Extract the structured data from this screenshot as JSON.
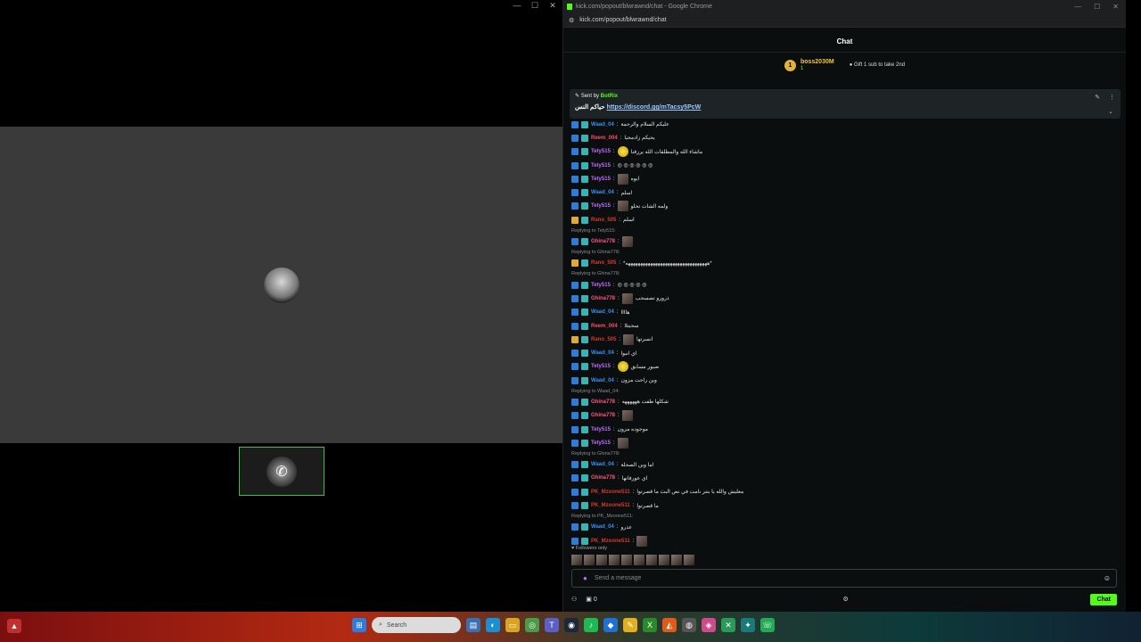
{
  "left": {
    "window_controls": [
      "—",
      "☐",
      "✕"
    ]
  },
  "chrome": {
    "title": "kick.com/popout/blwrawnd/chat - Google Chrome",
    "url": "kick.com/popout/blwrawnd/chat",
    "window_controls": [
      "—",
      "☐",
      "✕"
    ]
  },
  "chat": {
    "header": "Chat",
    "top_gifter": {
      "rank": "1",
      "name": "boss2030M",
      "count": "1",
      "cta": "Gift 1 sub to take 2nd"
    },
    "pinned": {
      "sent_by_label": "Sent by",
      "sender": "BotRix",
      "prefix": "حياكم النس",
      "link": "https://discord.gg/mTacsy5PcW"
    },
    "messages": [
      {
        "type": "msg",
        "user": "Waad_04",
        "cls": "n-waad",
        "text": "عليكم السلام والرحمة"
      },
      {
        "type": "msg",
        "user": "Reem_004",
        "cls": "n-reem",
        "text": "يحيكم زادمحيا"
      },
      {
        "type": "msg",
        "user": "Tety515",
        "cls": "n-tety",
        "text": "ماشاء الله والمطلقات الله يرزقنا",
        "emote": "y"
      },
      {
        "type": "msg",
        "user": "Tety515",
        "cls": "n-tety",
        "text": "◎ ◎ ◎ ◎ ◎ ◎"
      },
      {
        "type": "msg",
        "user": "Tety515",
        "cls": "n-tety",
        "text": "ايوه",
        "emote": "e"
      },
      {
        "type": "msg",
        "user": "Waad_04",
        "cls": "n-waad",
        "text": "اسلم"
      },
      {
        "type": "msg",
        "user": "Tety515",
        "cls": "n-tety",
        "text": "ولمه الشات تحلو",
        "emote": "e"
      },
      {
        "type": "msg",
        "user": "Rano_505",
        "cls": "n-rano",
        "gold": true,
        "text": "اسلم"
      },
      {
        "type": "reply",
        "text": "Replying to Tety515:"
      },
      {
        "type": "msg",
        "user": "Ghina778",
        "cls": "n-ghina",
        "text": "",
        "emote": "e"
      },
      {
        "type": "reply",
        "text": "Replying to Ghina778:"
      },
      {
        "type": "msg",
        "user": "Rano_505",
        "cls": "n-rano",
        "gold": true,
        "text": "*هههههههههههههههههههههههههههههههههه*"
      },
      {
        "type": "reply",
        "text": "Replying to Ghina778:"
      },
      {
        "type": "msg",
        "user": "Tety515",
        "cls": "n-tety",
        "text": "◎ ◎ ◎ ◎ ◎"
      },
      {
        "type": "msg",
        "user": "Ghina778",
        "cls": "n-ghina",
        "text": "ذرورو تصسحب",
        "emote": "e"
      },
      {
        "type": "msg",
        "user": "Waad_04",
        "cls": "n-waad",
        "text": "هاااا"
      },
      {
        "type": "msg",
        "user": "Reem_004",
        "cls": "n-reem",
        "text": "سحبتلا"
      },
      {
        "type": "msg",
        "user": "Rano_505",
        "cls": "n-rano",
        "gold": true,
        "text": "انسرتها",
        "emote": "e"
      },
      {
        "type": "msg",
        "user": "Waad_04",
        "cls": "n-waad",
        "text": "اي انبوا"
      },
      {
        "type": "msg",
        "user": "Tety515",
        "cls": "n-tety",
        "text": "صبور مسابق",
        "emote": "y"
      },
      {
        "type": "msg",
        "user": "Waad_04",
        "cls": "n-waad",
        "text": "وين راحت مزون"
      },
      {
        "type": "reply",
        "text": "Replying to Waad_04:"
      },
      {
        "type": "msg",
        "user": "Ghina778",
        "cls": "n-ghina",
        "text": "شكلها طفت ههههههه"
      },
      {
        "type": "msg",
        "user": "Ghina778",
        "cls": "n-ghina",
        "text": "",
        "emote": "e"
      },
      {
        "type": "msg",
        "user": "Tety515",
        "cls": "n-tety",
        "text": "موجوده مزون"
      },
      {
        "type": "msg",
        "user": "Tety515",
        "cls": "n-tety",
        "text": "",
        "emote": "e"
      },
      {
        "type": "reply",
        "text": "Replying to Ghina778:"
      },
      {
        "type": "msg",
        "user": "Waad_04",
        "cls": "n-waad",
        "text": "اما وين الصحلة"
      },
      {
        "type": "msg",
        "user": "Ghina778",
        "cls": "n-ghina",
        "text": "اي عورفاتها"
      },
      {
        "type": "msg",
        "user": "PK_Mzoone511",
        "cls": "n-pk",
        "text": "معليش والله يا بنتر نامت في نص البث ما قصرتوا"
      },
      {
        "type": "msg",
        "user": "PK_Mzoone511",
        "cls": "n-pk",
        "text": "ما قصرتوا"
      },
      {
        "type": "reply",
        "text": "Replying to PK_Mzoone511:"
      },
      {
        "type": "msg",
        "user": "Waad_04",
        "cls": "n-waad",
        "text": "عذرو"
      },
      {
        "type": "msg",
        "user": "PK_Mzoone511",
        "cls": "n-pk",
        "text": "",
        "emote": "e"
      }
    ],
    "followers_only": "Followers only",
    "input_placeholder": "Send a message",
    "points": "0",
    "send_label": "Chat"
  },
  "taskbar": {
    "search_placeholder": "Search"
  },
  "colors": {
    "kick_green": "#53fc18",
    "bg": "#0b0e0f"
  }
}
